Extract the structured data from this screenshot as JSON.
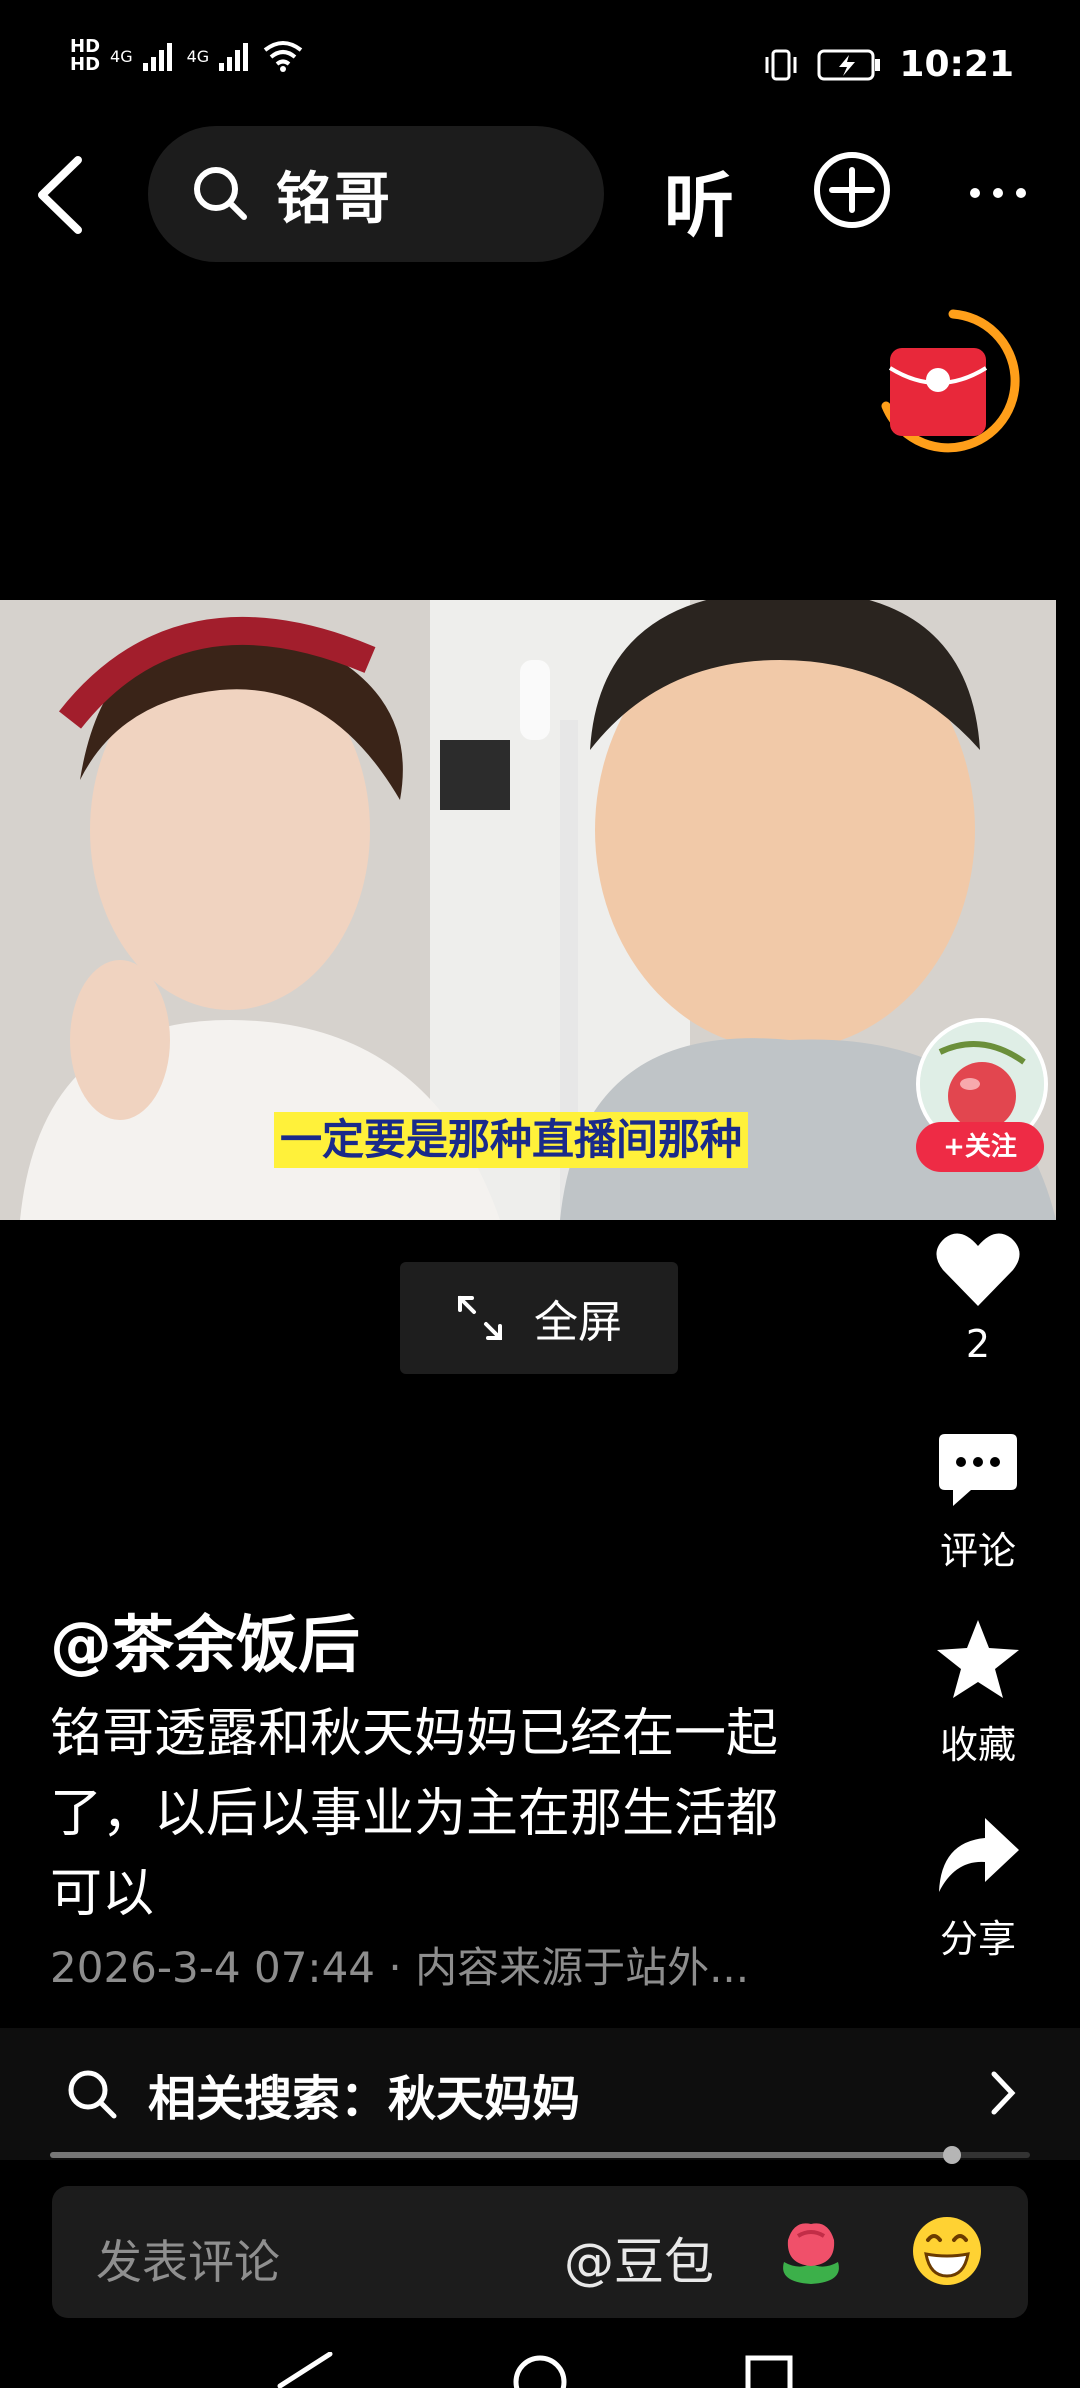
{
  "status_bar": {
    "hd1": "HD",
    "hd2": "HD",
    "signal1": "4G",
    "signal2": "4G",
    "time": "10:21"
  },
  "top_bar": {
    "search_query": "铭哥",
    "listen_label": "听"
  },
  "video": {
    "caption": "一定要是那种直播间那种",
    "fullscreen_label": "全屏"
  },
  "author_follow": "+关注",
  "actions": {
    "like_count": "2",
    "comment_label": "评论",
    "favorite_label": "收藏",
    "share_label": "分享"
  },
  "post": {
    "author": "@茶余饭后",
    "description": "铭哥透露和秋天妈妈已经在一起了，以后以事业为主在那生活都可以",
    "meta": "2026-3-4 07:44 · 内容来源于站外..."
  },
  "related_search": {
    "label": "相关搜索：秋天妈妈"
  },
  "playback_progress": 0.92,
  "comment_bar": {
    "placeholder": "发表评论",
    "mention": "@豆包"
  },
  "colors": {
    "accent_red": "#ee2b45",
    "redpack_ring": "#ff9f1a",
    "caption_bg": "#fff13a",
    "caption_text": "#1a2a8a"
  }
}
